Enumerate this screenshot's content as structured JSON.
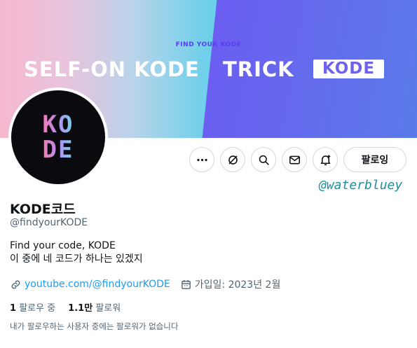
{
  "banner": {
    "kicker": "FIND YOUR KODE",
    "left_text": "SELF-ON KODE",
    "right_text": "TRICK",
    "badge_text": "KODE",
    "colors": {
      "pink": "#f5b8cf",
      "cyan": "#67cfe8",
      "purple": "#7a3ef0"
    }
  },
  "avatar": {
    "line1": "KO",
    "line2": "DE"
  },
  "actions": {
    "more_icon": "more-icon",
    "grok_icon": "grok-icon",
    "search_icon": "search-icon",
    "message_icon": "envelope-icon",
    "notify_icon": "bell-plus-icon",
    "follow_label": "팔로잉"
  },
  "watermark": "@waterbluey",
  "profile": {
    "name": "KODE코드",
    "handle": "@findyourKODE",
    "bio_line1": "Find your code, KODE",
    "bio_line2": "이 중에 네 코드가 하나는 있겠지",
    "link": "youtube.com/@findyourKODE",
    "joined": "가입일: 2023년 2월",
    "following_count": "1",
    "following_label": "팔로우 중",
    "followers_count": "1.1만",
    "followers_label": "팔로워",
    "followers_note": "내가 팔로우하는 사용자 중에는 팔로워가 없습니다"
  }
}
